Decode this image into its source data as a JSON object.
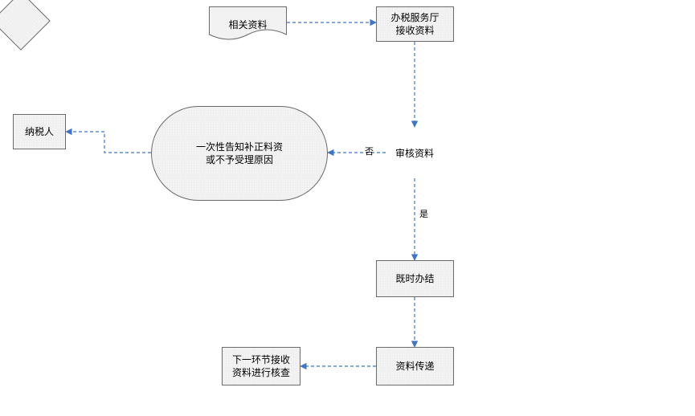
{
  "chart_data": {
    "type": "flowchart",
    "title": "",
    "nodes": [
      {
        "id": "docs",
        "shape": "document",
        "label": "相关资料"
      },
      {
        "id": "receive",
        "shape": "process",
        "label": "办税服务厅\n接收资料"
      },
      {
        "id": "review",
        "shape": "decision",
        "label": "审核资料"
      },
      {
        "id": "notify",
        "shape": "terminator",
        "label": "一次性告知补正料资\n或不予受理原因"
      },
      {
        "id": "taxpayer",
        "shape": "process",
        "label": "纳税人"
      },
      {
        "id": "handle",
        "shape": "process",
        "label": "既时办结"
      },
      {
        "id": "transfer",
        "shape": "process",
        "label": "资料传递"
      },
      {
        "id": "next",
        "shape": "process",
        "label": "下一环节接收\n资料进行核查"
      }
    ],
    "edges": [
      {
        "from": "docs",
        "to": "receive",
        "label": ""
      },
      {
        "from": "receive",
        "to": "review",
        "label": ""
      },
      {
        "from": "review",
        "to": "notify",
        "label": "否"
      },
      {
        "from": "review",
        "to": "handle",
        "label": "是"
      },
      {
        "from": "notify",
        "to": "taxpayer",
        "label": ""
      },
      {
        "from": "handle",
        "to": "transfer",
        "label": ""
      },
      {
        "from": "transfer",
        "to": "next",
        "label": ""
      }
    ]
  },
  "nodes": {
    "docs": "相关资料",
    "receive_l1": "办税服务厅",
    "receive_l2": "接收资料",
    "review": "审核资料",
    "notify_l1": "一次性告知补正料资",
    "notify_l2": "或不予受理原因",
    "taxpayer": "纳税人",
    "handle": "既时办结",
    "transfer": "资料传递",
    "next_l1": "下一环节接收",
    "next_l2": "资料进行核查"
  },
  "labels": {
    "no": "否",
    "yes": "是"
  },
  "colors": {
    "edge": "#3e74c9",
    "border": "#6a6a6a",
    "fill": "#f2f2f2"
  }
}
